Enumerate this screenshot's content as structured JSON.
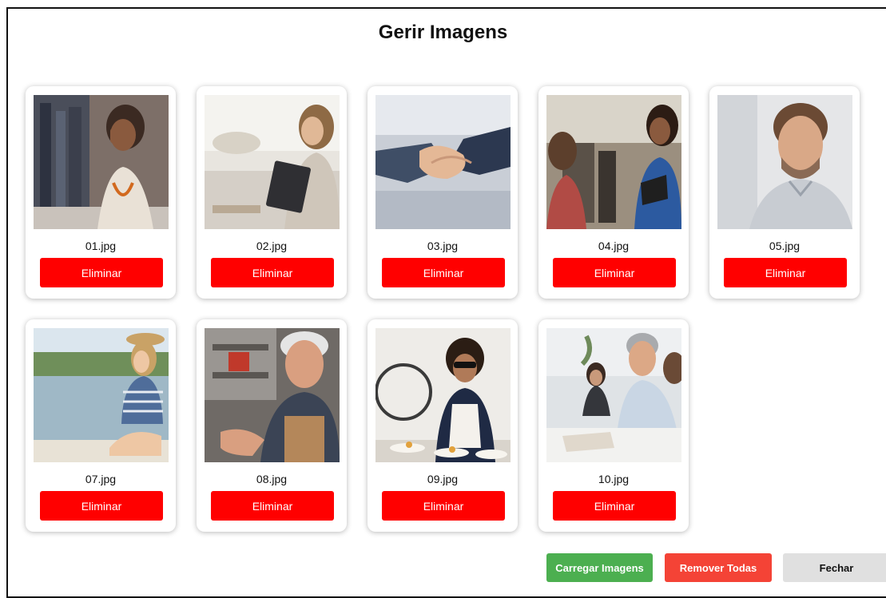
{
  "dialog": {
    "title": "Gerir Imagens"
  },
  "images": [
    {
      "filename": "01.jpg",
      "delete_label": "Eliminar"
    },
    {
      "filename": "02.jpg",
      "delete_label": "Eliminar"
    },
    {
      "filename": "03.jpg",
      "delete_label": "Eliminar"
    },
    {
      "filename": "04.jpg",
      "delete_label": "Eliminar"
    },
    {
      "filename": "05.jpg",
      "delete_label": "Eliminar"
    },
    {
      "filename": "07.jpg",
      "delete_label": "Eliminar"
    },
    {
      "filename": "08.jpg",
      "delete_label": "Eliminar"
    },
    {
      "filename": "09.jpg",
      "delete_label": "Eliminar"
    },
    {
      "filename": "10.jpg",
      "delete_label": "Eliminar"
    }
  ],
  "footer": {
    "upload_label": "Carregar Imagens",
    "remove_all_label": "Remover Todas",
    "close_label": "Fechar"
  },
  "colors": {
    "delete": "#ff0000",
    "upload": "#4caf50",
    "remove_all": "#f44336",
    "close": "#e0e0e0"
  }
}
